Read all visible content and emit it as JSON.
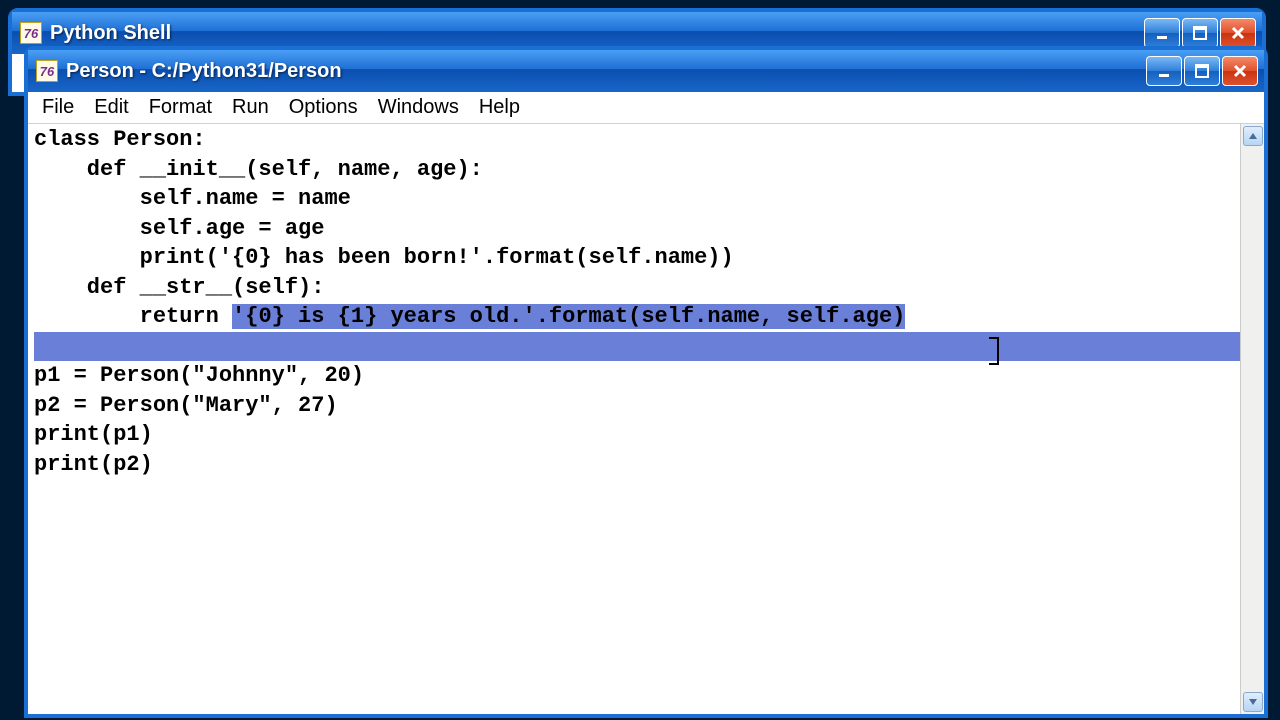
{
  "back_window": {
    "title": "Python Shell"
  },
  "front_window": {
    "title": "Person - C:/Python31/Person",
    "menu": [
      "File",
      "Edit",
      "Format",
      "Run",
      "Options",
      "Windows",
      "Help"
    ]
  },
  "code": {
    "l0": "class Person:",
    "l1": "    def __init__(self, name, age):",
    "l2": "        self.name = name",
    "l3": "        self.age = age",
    "l4": "        print('{0} has been born!'.format(self.name))",
    "l5": "    def __str__(self):",
    "l6a": "        return ",
    "l6b": "'{0} is {1} years old.'.format(self.name, self.age)",
    "l7": "",
    "l8": "p1 = Person(\"Johnny\", 20)",
    "l9": "p2 = Person(\"Mary\", 27)",
    "l10": "print(p1)",
    "l11": "print(p2)"
  }
}
